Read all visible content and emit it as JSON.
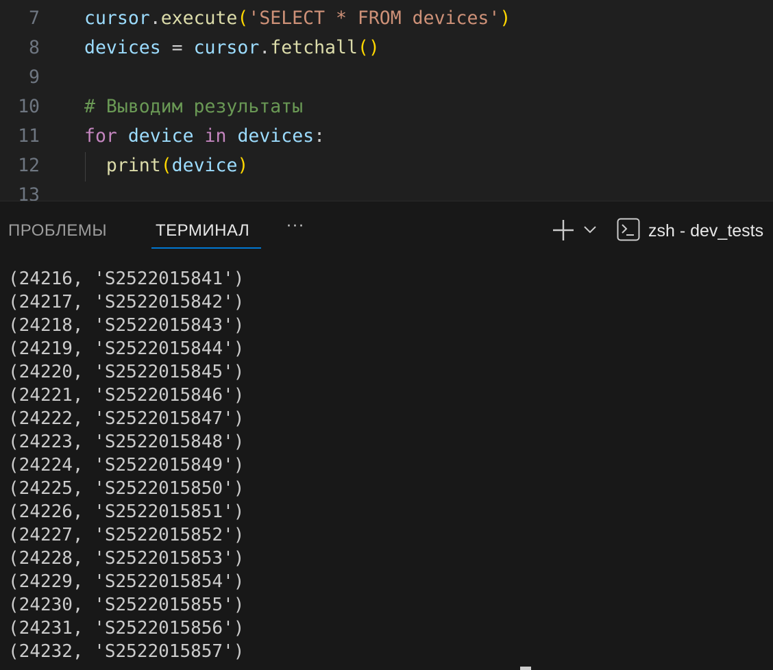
{
  "editor": {
    "lines": [
      {
        "num": "7",
        "tokens": [
          {
            "t": "cursor",
            "c": "var"
          },
          {
            "t": ".",
            "c": "plain"
          },
          {
            "t": "execute",
            "c": "fn"
          },
          {
            "t": "(",
            "c": "p1"
          },
          {
            "t": "'SELECT * FROM devices'",
            "c": "str"
          },
          {
            "t": ")",
            "c": "p1"
          }
        ]
      },
      {
        "num": "8",
        "tokens": [
          {
            "t": "devices",
            "c": "var"
          },
          {
            "t": " = ",
            "c": "plain"
          },
          {
            "t": "cursor",
            "c": "var"
          },
          {
            "t": ".",
            "c": "plain"
          },
          {
            "t": "fetchall",
            "c": "fn"
          },
          {
            "t": "()",
            "c": "p1"
          }
        ]
      },
      {
        "num": "9",
        "tokens": []
      },
      {
        "num": "10",
        "tokens": [
          {
            "t": "# Выводим результаты",
            "c": "cmt"
          }
        ]
      },
      {
        "num": "11",
        "tokens": [
          {
            "t": "for",
            "c": "kw"
          },
          {
            "t": " ",
            "c": "plain"
          },
          {
            "t": "device",
            "c": "var"
          },
          {
            "t": " ",
            "c": "plain"
          },
          {
            "t": "in",
            "c": "kw"
          },
          {
            "t": " ",
            "c": "plain"
          },
          {
            "t": "devices",
            "c": "var"
          },
          {
            "t": ":",
            "c": "plain"
          }
        ]
      },
      {
        "num": "12",
        "tokens": [
          {
            "t": "  ",
            "c": "plain"
          },
          {
            "t": "print",
            "c": "fn"
          },
          {
            "t": "(",
            "c": "p1"
          },
          {
            "t": "device",
            "c": "var"
          },
          {
            "t": ")",
            "c": "p1"
          }
        ]
      },
      {
        "num": "13",
        "tokens": []
      }
    ]
  },
  "panel": {
    "tabs": [
      {
        "label": "ПРОБЛЕМЫ",
        "active": false
      },
      {
        "label": "ТЕРМИНАЛ",
        "active": true
      }
    ],
    "more_label": "···",
    "terminal_name": "zsh - dev_tests",
    "icons": {
      "new_terminal": "plus-icon",
      "dropdown": "chevron-down-icon",
      "terminal": "terminal-icon"
    }
  },
  "terminal": {
    "output": [
      "(24216, 'S2522015841')",
      "(24217, 'S2522015842')",
      "(24218, 'S2522015843')",
      "(24219, 'S2522015844')",
      "(24220, 'S2522015845')",
      "(24221, 'S2522015846')",
      "(24222, 'S2522015847')",
      "(24223, 'S2522015848')",
      "(24224, 'S2522015849')",
      "(24225, 'S2522015850')",
      "(24226, 'S2522015851')",
      "(24227, 'S2522015852')",
      "(24228, 'S2522015853')",
      "(24229, 'S2522015854')",
      "(24230, 'S2522015855')",
      "(24231, 'S2522015856')",
      "(24232, 'S2522015857')"
    ]
  }
}
